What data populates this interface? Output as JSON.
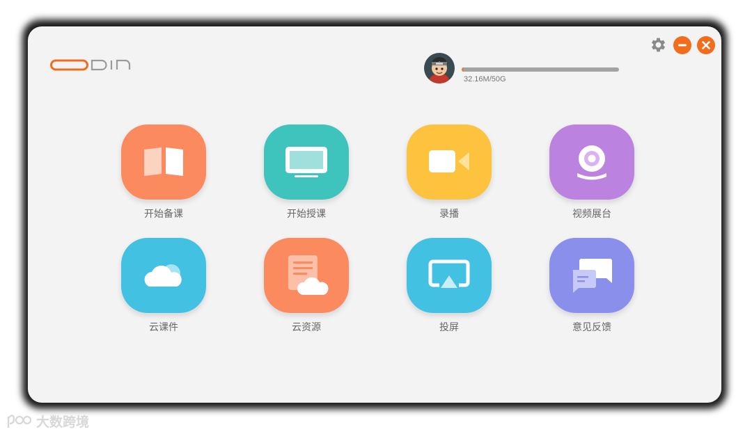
{
  "app": {
    "logo_text": "ODIN"
  },
  "storage": {
    "used_text": "32.16M/50G",
    "used_fraction": 0.006
  },
  "window_controls": {
    "settings_icon": "gear-icon",
    "minimize_icon": "minimize-icon",
    "close_icon": "close-icon"
  },
  "tiles": [
    {
      "label": "开始备课",
      "icon": "open-book-icon",
      "color": "#fb8a5e"
    },
    {
      "label": "开始授课",
      "icon": "monitor-icon",
      "color": "#3fc3bd"
    },
    {
      "label": "录播",
      "icon": "video-camera-icon",
      "color": "#fdc33f"
    },
    {
      "label": "视频展台",
      "icon": "webcam-icon",
      "color": "#bb82e0"
    },
    {
      "label": "云课件",
      "icon": "cloud-icon",
      "color": "#43c1e3"
    },
    {
      "label": "云资源",
      "icon": "cloud-document-icon",
      "color": "#fb8a5e"
    },
    {
      "label": "投屏",
      "icon": "screen-cast-icon",
      "color": "#43c1e3"
    },
    {
      "label": "意见反馈",
      "icon": "chat-bubbles-icon",
      "color": "#8b8fec"
    }
  ],
  "watermark": {
    "text": "大数跨境"
  }
}
